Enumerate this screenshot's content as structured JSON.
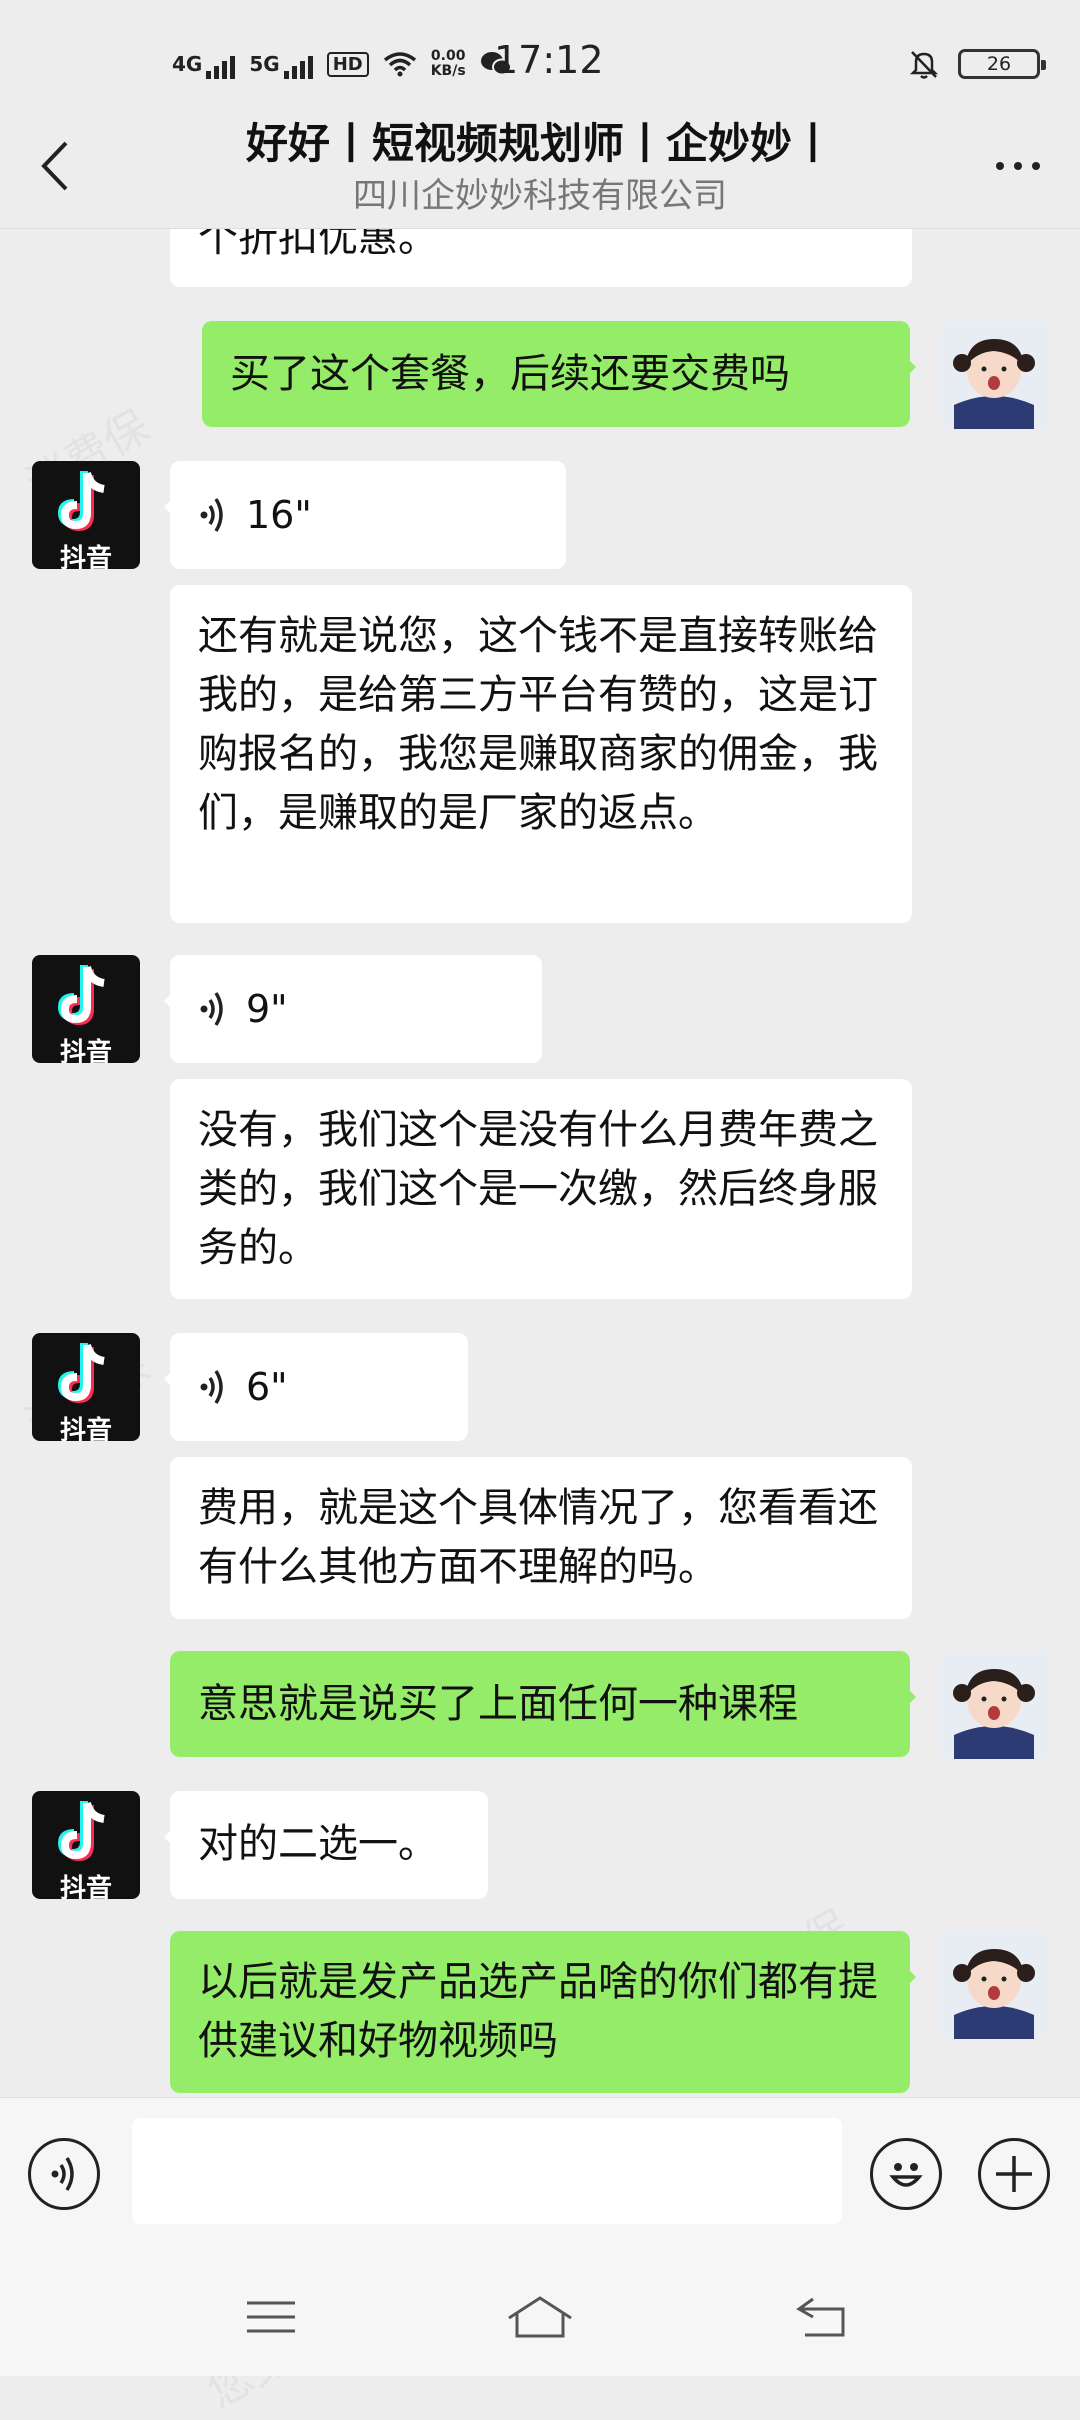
{
  "status_bar": {
    "net1": "4G",
    "net2": "5G",
    "hd": "HD",
    "speed_value": "0.00",
    "speed_unit": "KB/s",
    "time": "17:12",
    "battery": "26"
  },
  "header": {
    "title": "好好丨短视频规划师丨企妙妙丨",
    "subtitle": "四川企妙妙科技有限公司"
  },
  "avatars": {
    "douyin_label": "抖音"
  },
  "messages": [
    {
      "side": "in",
      "type": "text",
      "text": "个折扣优惠。"
    },
    {
      "side": "out",
      "type": "text",
      "text": "买了这个套餐，后续还要交费吗"
    },
    {
      "side": "in",
      "type": "voice",
      "duration": "16\""
    },
    {
      "side": "in",
      "type": "text",
      "text": "还有就是说您，这个钱不是直接转账给我的，是给第三方平台有赞的，这是订购报名的，我您是赚取商家的佣金，我们，是赚取的是厂家的返点。"
    },
    {
      "side": "in",
      "type": "voice",
      "duration": "9\""
    },
    {
      "side": "in",
      "type": "text",
      "text": "没有，我们这个是没有什么月费年费之类的，我们这个是一次缴，然后终身服务的。"
    },
    {
      "side": "in",
      "type": "voice",
      "duration": "6\""
    },
    {
      "side": "in",
      "type": "text",
      "text": "费用，就是这个具体情况了，您看看还有什么其他方面不理解的吗。"
    },
    {
      "side": "out",
      "type": "text",
      "text": "意思就是说买了上面任何一种课程"
    },
    {
      "side": "in",
      "type": "text",
      "text": "对的二选一。"
    },
    {
      "side": "out",
      "type": "text",
      "text": "以后就是发产品选产品啥的你们都有提供建议和好物视频吗"
    }
  ],
  "watermark": {
    "text1": "消费保",
    "text2": "您身边的消费服务管家"
  },
  "colors": {
    "background": "#ededed",
    "outgoing_bubble": "#95ec69",
    "incoming_bubble": "#ffffff"
  },
  "icons": [
    "back-arrow-icon",
    "more-dots-icon",
    "voice-wave-icon",
    "emoji-icon",
    "plus-icon",
    "menu-icon",
    "home-icon",
    "back-nav-icon",
    "douyin-logo-icon"
  ]
}
